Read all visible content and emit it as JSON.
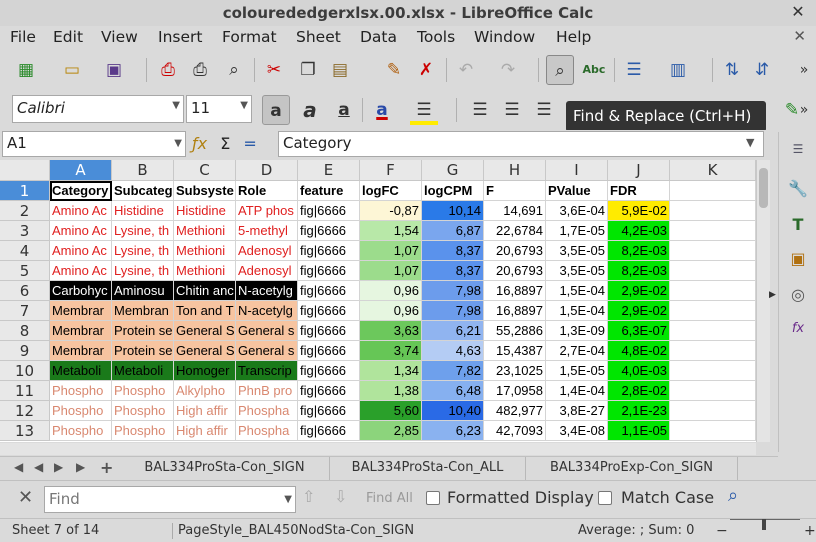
{
  "window_title": "colourededgerxlsx.00.xlsx - LibreOffice Calc",
  "menu": [
    "File",
    "Edit",
    "View",
    "Insert",
    "Format",
    "Sheet",
    "Data",
    "Tools",
    "Window",
    "Help"
  ],
  "font": {
    "name": "Calibri",
    "size": "11"
  },
  "tooltip": "Find & Replace (Ctrl+H)",
  "name_box": "A1",
  "formula_value": "Category",
  "columns": [
    "A",
    "B",
    "C",
    "D",
    "E",
    "F",
    "G",
    "H",
    "I",
    "J",
    "K"
  ],
  "rows": [
    "1",
    "2",
    "3",
    "4",
    "5",
    "6",
    "7",
    "8",
    "9",
    "10",
    "11",
    "12",
    "13"
  ],
  "table": [
    [
      "Category",
      "Subcateg",
      "Subsyste",
      "Role",
      "feature",
      "logFC",
      "logCPM",
      "F",
      "PValue",
      "FDR",
      ""
    ],
    [
      "Amino Ac",
      "Histidine",
      "Histidine",
      "ATP phos",
      "fig|6666",
      "-0,87",
      "10,14",
      "14,691",
      "3,6E-04",
      "5,9E-02",
      ""
    ],
    [
      "Amino Ac",
      "Lysine, th",
      "Methioni",
      "5-methyl",
      "fig|6666",
      "1,54",
      "6,87",
      "22,6784",
      "1,7E-05",
      "4,2E-03",
      ""
    ],
    [
      "Amino Ac",
      "Lysine, th",
      "Methioni",
      "Adenosyl",
      "fig|6666",
      "1,07",
      "8,37",
      "20,6793",
      "3,5E-05",
      "8,2E-03",
      ""
    ],
    [
      "Amino Ac",
      "Lysine, th",
      "Methioni",
      "Adenosyl",
      "fig|6666",
      "1,07",
      "8,37",
      "20,6793",
      "3,5E-05",
      "8,2E-03",
      ""
    ],
    [
      "Carbohyc",
      "Aminosu",
      "Chitin anc",
      "N-acetylg",
      "fig|6666",
      "0,96",
      "7,98",
      "16,8897",
      "1,5E-04",
      "2,9E-02",
      ""
    ],
    [
      "Membrar",
      "Membran",
      "Ton and T",
      "N-acetylg",
      "fig|6666",
      "0,96",
      "7,98",
      "16,8897",
      "1,5E-04",
      "2,9E-02",
      ""
    ],
    [
      "Membrar",
      "Protein se",
      "General S",
      "General s",
      "fig|6666",
      "3,63",
      "6,21",
      "55,2886",
      "1,3E-09",
      "6,3E-07",
      ""
    ],
    [
      "Membrar",
      "Protein se",
      "General S",
      "General s",
      "fig|6666",
      "3,74",
      "4,63",
      "15,4387",
      "2,7E-04",
      "4,8E-02",
      ""
    ],
    [
      "Metaboli",
      "Metaboli",
      "Homoger",
      "Transcrip",
      "fig|6666",
      "1,34",
      "7,82",
      "23,1025",
      "1,5E-05",
      "4,0E-03",
      ""
    ],
    [
      "Phospho",
      "Phospho",
      "Alkylpho",
      "PhnB pro",
      "fig|6666",
      "1,38",
      "6,48",
      "17,0958",
      "1,4E-04",
      "2,8E-02",
      ""
    ],
    [
      "Phospho",
      "Phospho",
      "High affir",
      "Phospha",
      "fig|6666",
      "5,60",
      "10,40",
      "482,977",
      "3,8E-27",
      "2,1E-23",
      ""
    ],
    [
      "Phospho",
      "Phospho",
      "High affir",
      "Phospha",
      "fig|6666",
      "2,85",
      "6,23",
      "42,7093",
      "3,4E-08",
      "1,1E-05",
      ""
    ]
  ],
  "sheet_tabs": [
    "BAL334ProSta-Con_SIGN",
    "BAL334ProSta-Con_ALL",
    "BAL334ProExp-Con_SIGN"
  ],
  "find": {
    "placeholder": "Find",
    "find_all": "Find All",
    "formatted_display": "Formatted Display",
    "match_case": "Match Case"
  },
  "status": {
    "sheet": "Sheet 7 of 14",
    "page_style": "PageStyle_BAL450NodSta-Con_SIGN",
    "summary": "Average: ; Sum: 0"
  },
  "colors": {
    "selection": "#4a8dd8",
    "fdr_green": "#00e600",
    "fdr_yellow": "#ffeb00"
  }
}
